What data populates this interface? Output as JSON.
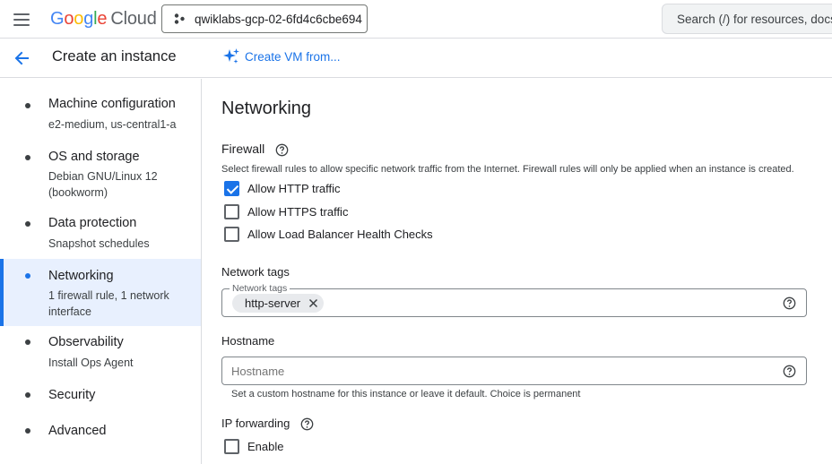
{
  "header": {
    "logo_letters": [
      "G",
      "o",
      "o",
      "g",
      "l",
      "e"
    ],
    "logo_cloud": "Cloud",
    "project": "qwiklabs-gcp-02-6fd4c6cbe694",
    "search_placeholder": "Search (/) for resources, docs,"
  },
  "subheader": {
    "title": "Create an instance",
    "create_from": "Create VM from..."
  },
  "sidebar": {
    "items": [
      {
        "title": "Machine configuration",
        "sub": "e2-medium, us-central1-a",
        "active": false
      },
      {
        "title": "OS and storage",
        "sub": "Debian GNU/Linux 12 (bookworm)",
        "active": false
      },
      {
        "title": "Data protection",
        "sub": "Snapshot schedules",
        "active": false
      },
      {
        "title": "Networking",
        "sub": "1 firewall rule, 1 network interface",
        "active": true
      },
      {
        "title": "Observability",
        "sub": "Install Ops Agent",
        "active": false
      },
      {
        "title": "Security",
        "sub": "",
        "active": false
      },
      {
        "title": "Advanced",
        "sub": "",
        "active": false
      }
    ]
  },
  "main": {
    "heading": "Networking",
    "firewall": {
      "title": "Firewall",
      "description": "Select firewall rules to allow specific network traffic from the Internet. Firewall rules will only be applied when an instance is created.",
      "options": [
        {
          "label": "Allow HTTP traffic",
          "checked": true
        },
        {
          "label": "Allow HTTPS traffic",
          "checked": false
        },
        {
          "label": "Allow Load Balancer Health Checks",
          "checked": false
        }
      ]
    },
    "network_tags": {
      "title": "Network tags",
      "field_label": "Network tags",
      "chips": [
        "http-server"
      ]
    },
    "hostname": {
      "title": "Hostname",
      "placeholder": "Hostname",
      "hint": "Set a custom hostname for this instance or leave it default. Choice is permanent"
    },
    "ip_forwarding": {
      "title": "IP forwarding",
      "enable_label": "Enable",
      "checked": false
    }
  },
  "colors": {
    "accent": "#1a73e8",
    "active_bg": "#e8f0fe",
    "divider": "#dadce0"
  }
}
